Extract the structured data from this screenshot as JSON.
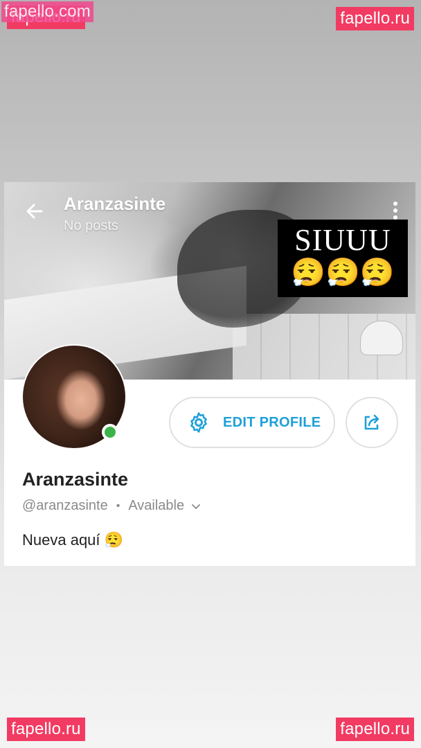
{
  "watermarks": {
    "top_left_primary": "fapello.ru",
    "top_left_overlay": "fapello.com",
    "top_right": "fapello.ru",
    "bottom_left": "fapello.ru",
    "bottom_right": "fapello.ru"
  },
  "header": {
    "title": "Aranzasinte",
    "subtitle": "No posts",
    "back_icon": "arrow-left-icon",
    "menu_icon": "more-vertical-icon"
  },
  "cover_sticker": {
    "text": "SIUUU",
    "emojis": "😮‍💨😮‍💨😮‍💨"
  },
  "profile": {
    "name": "Aranzasinte",
    "handle": "@aranzasinte",
    "separator": "•",
    "status": "Available",
    "bio": "Nueva aquí 😮‍💨"
  },
  "actions": {
    "edit_profile_label": "EDIT PROFILE",
    "edit_icon": "gear-icon",
    "share_icon": "share-icon"
  },
  "colors": {
    "accent": "#1ea0d8",
    "online": "#3cb34a",
    "watermark": "#f23b62"
  }
}
